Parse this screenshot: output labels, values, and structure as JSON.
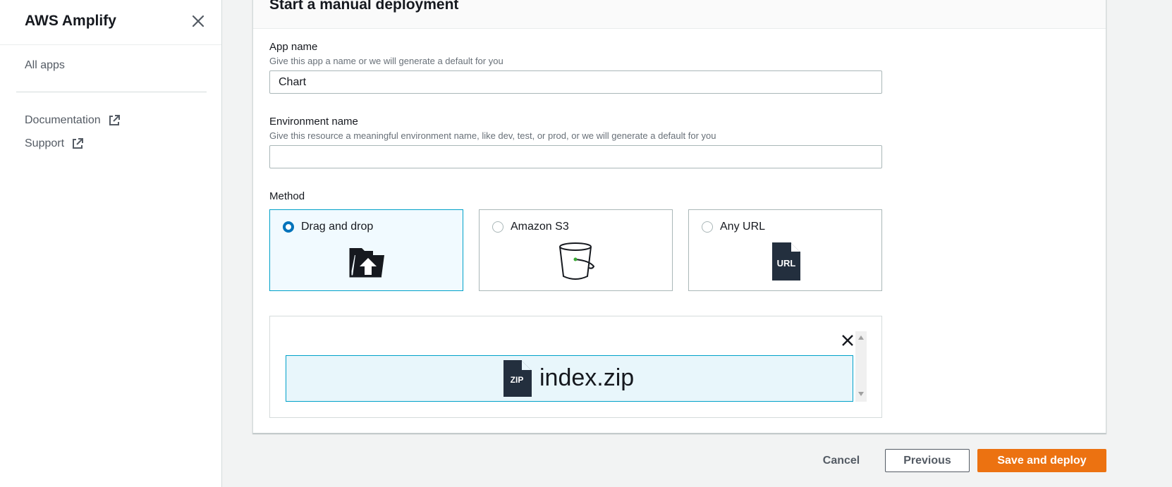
{
  "sidebar": {
    "title": "AWS Amplify",
    "links": [
      {
        "label": "All apps"
      },
      {
        "label": "Documentation"
      },
      {
        "label": "Support"
      }
    ]
  },
  "panel": {
    "title": "Start a manual deployment",
    "app_name": {
      "label": "App name",
      "description": "Give this app a name or we will generate a default for you",
      "value": "Chart"
    },
    "environment_name": {
      "label": "Environment name",
      "description": "Give this resource a meaningful environment name, like dev, test, or prod, or we will generate a default for you",
      "value": ""
    },
    "method": {
      "label": "Method",
      "options": [
        {
          "label": "Drag and drop",
          "icon": "folder-upload-icon",
          "selected": true
        },
        {
          "label": "Amazon S3",
          "icon": "bucket-icon",
          "selected": false
        },
        {
          "label": "Any URL",
          "icon": "url-file-icon",
          "selected": false
        }
      ]
    },
    "upload": {
      "file_name": "index.zip",
      "file_icon": "zip-file-icon",
      "file_icon_text": "ZIP"
    }
  },
  "footer": {
    "cancel_label": "Cancel",
    "previous_label": "Previous",
    "submit_label": "Save and deploy"
  },
  "colors": {
    "accent": "#0073bb",
    "selected_border": "#00a1c9",
    "primary_button": "#ec7211",
    "page_background": "#f2f3f3"
  }
}
